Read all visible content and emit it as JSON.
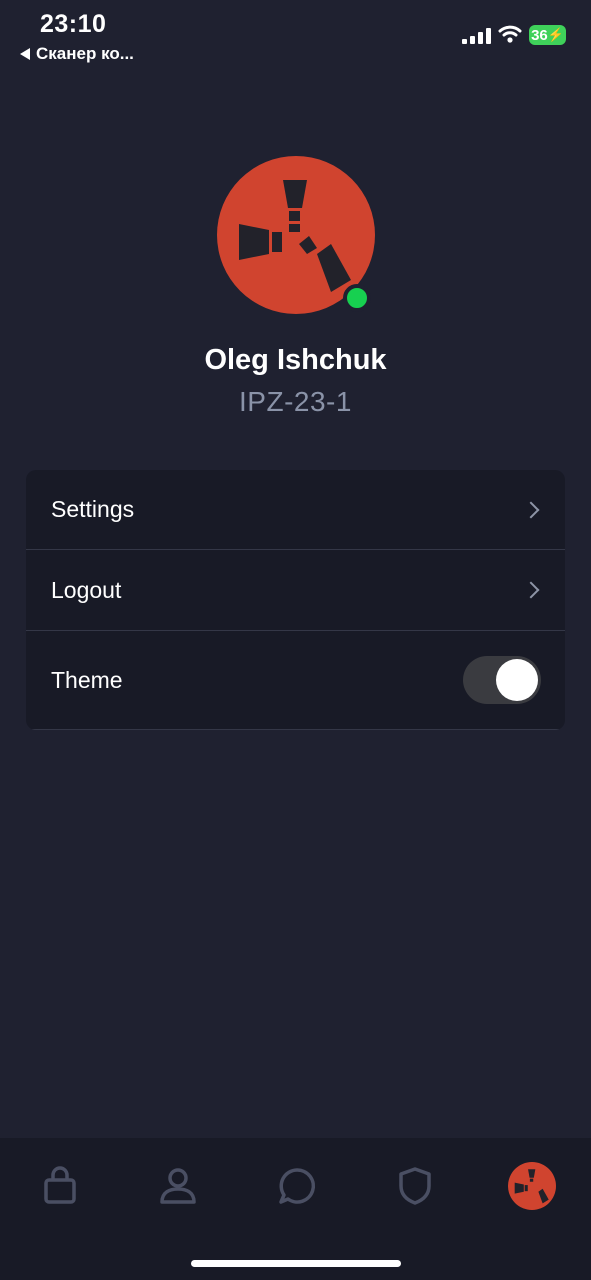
{
  "status_bar": {
    "time": "23:10",
    "back_app": "Сканер ко...",
    "battery": "36"
  },
  "profile": {
    "name": "Oleg Ishchuk",
    "group": "IPZ-23-1",
    "online": true,
    "avatar_icon": "rust-logo-icon"
  },
  "menu": {
    "items": [
      {
        "label": "Settings",
        "type": "link"
      },
      {
        "label": "Logout",
        "type": "link"
      },
      {
        "label": "Theme",
        "type": "toggle",
        "on": true
      }
    ]
  },
  "tabbar": {
    "tabs": [
      {
        "icon": "shopping-bag-icon"
      },
      {
        "icon": "user-icon"
      },
      {
        "icon": "chat-bubble-icon"
      },
      {
        "icon": "shield-icon"
      },
      {
        "icon": "profile-avatar-icon",
        "active": true
      }
    ]
  },
  "colors": {
    "background": "#1f2130",
    "card": "#181a26",
    "accent": "#d0442f",
    "online": "#17d050",
    "muted_text": "#8a93a8"
  }
}
